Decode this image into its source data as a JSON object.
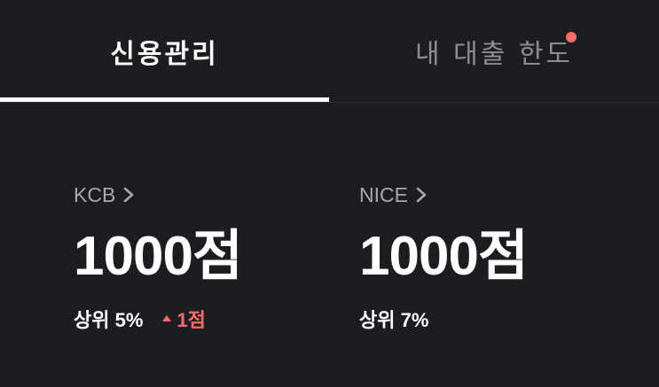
{
  "tabs": {
    "credit_label": "신용관리",
    "loan_label": "내 대출 한도"
  },
  "scores": [
    {
      "bureau": "KCB",
      "score": "1000점",
      "rank": "상위 5%",
      "change": "1점"
    },
    {
      "bureau": "NICE",
      "score": "1000점",
      "rank": "상위 7%"
    }
  ],
  "colors": {
    "background": "#1c1d20",
    "accent_red": "#ff6b6b",
    "muted_text": "#a7a8ac"
  },
  "icons": {
    "bureau_link": "chevron-right-icon",
    "change_up": "triangle-up-icon",
    "notification": "red-dot-badge"
  }
}
